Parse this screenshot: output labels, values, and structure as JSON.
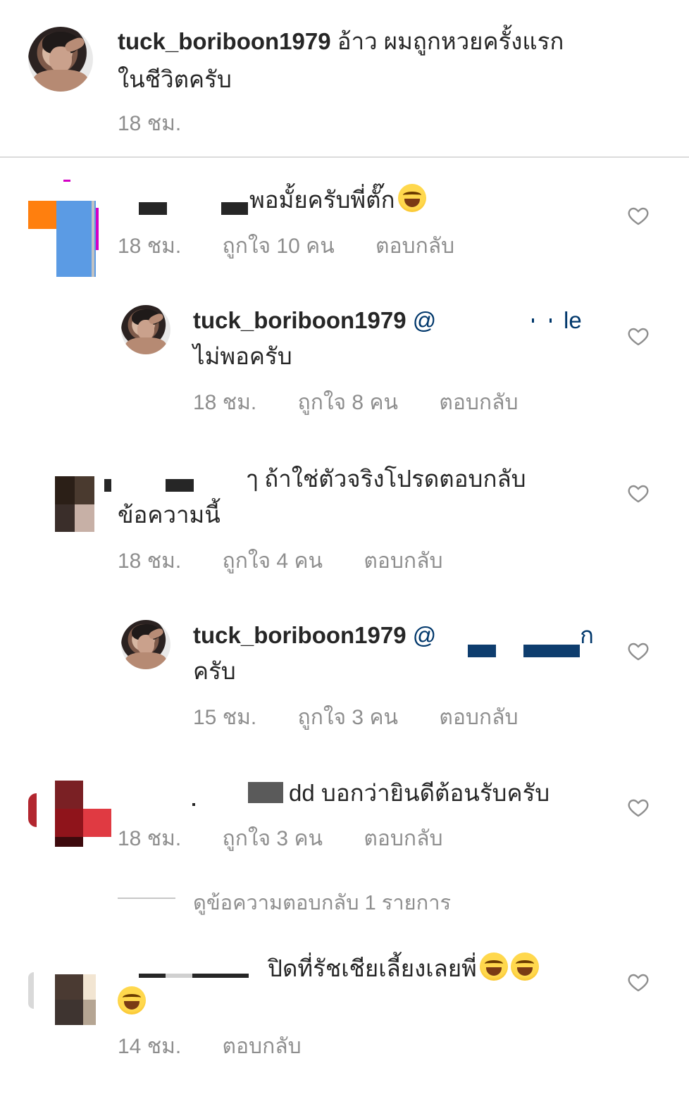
{
  "caption": {
    "username": "tuck_boriboon1979",
    "text_line1": "อ้าว ผมถูกหวยครั้งแรก",
    "text_line2": "ในชีวิตครับ",
    "time": "18 ชม."
  },
  "comments": [
    {
      "text": "พอมั้ยครับพี่ตั๊ก",
      "time": "18 ชม.",
      "likes": "ถูกใจ 10 คน",
      "reply": "ตอบกลับ"
    },
    {
      "username": "tuck_boriboon1979",
      "mention_start": "@",
      "mention_end": "le",
      "text": "ไม่พอครับ",
      "time": "18 ชม.",
      "likes": "ถูกใจ 8 คน",
      "reply": "ตอบกลับ"
    },
    {
      "text_line1_end": "ๅ ถ้าใช่ตัวจริงโปรดตอบกลับ",
      "text_line2": "ข้อความนี้",
      "time": "18 ชม.",
      "likes": "ถูกใจ 4 คน",
      "reply": "ตอบกลับ"
    },
    {
      "username": "tuck_boriboon1979",
      "mention_start": "@",
      "mention_end": "ก",
      "text": "ครับ",
      "time": "15 ชม.",
      "likes": "ถูกใจ 3 คน",
      "reply": "ตอบกลับ"
    },
    {
      "text": "dd บอกว่ายินดีต้อนรับครับ",
      "time": "18 ชม.",
      "likes": "ถูกใจ 3 คน",
      "reply": "ตอบกลับ",
      "view_replies": "ดูข้อความตอบกลับ 1 รายการ"
    },
    {
      "text": "ปิดที่รัชเชียเลี้ยงเลยพี่",
      "time": "14 ชม.",
      "reply": "ตอบกลับ"
    }
  ],
  "icons": {
    "like": "heart-outline-icon",
    "emoji": "laughing-emoji-icon"
  },
  "colors": {
    "text": "#262626",
    "meta": "#8e8e8e",
    "mention": "#00376b",
    "divider": "#dbdbdb"
  }
}
